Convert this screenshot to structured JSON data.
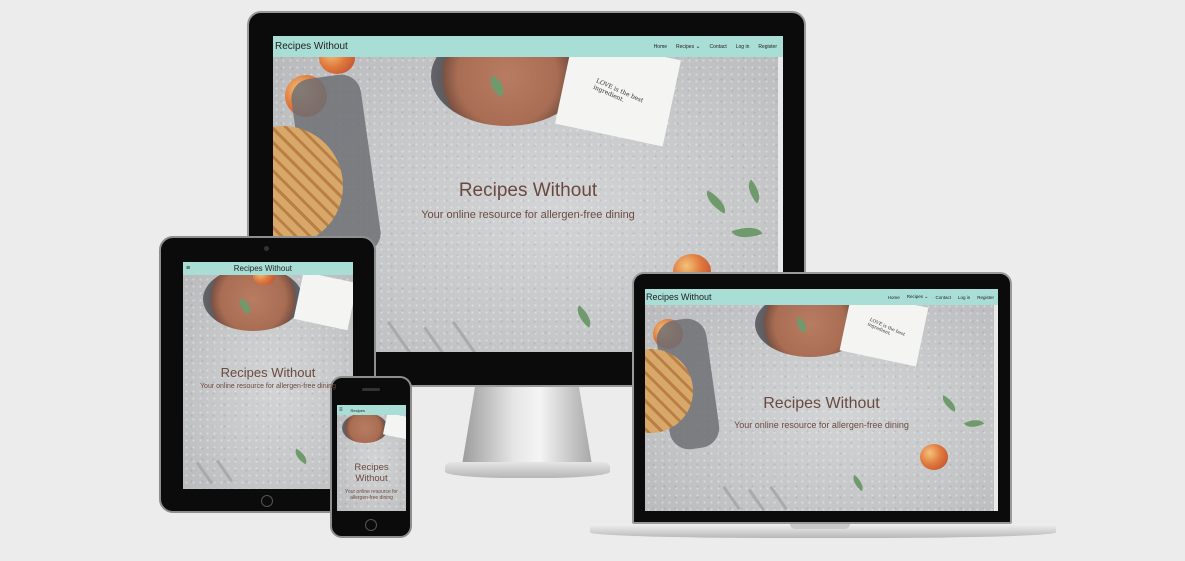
{
  "site": {
    "brand": "Recipes Without",
    "nav": [
      "Home",
      "Recipes",
      "Contact",
      "Log in",
      "Register"
    ],
    "hero_title": "Recipes Without",
    "hero_subtitle": "Your online resource for allergen-free dining",
    "napkin_text": "LOVE is the best ingredient.",
    "phone_nav_brand": "Recipes",
    "phone_hero_title": "Recipes Without",
    "phone_hero_subtitle": "Your online resource for allergen-free dining"
  },
  "colors": {
    "navbar": "#a8ded5",
    "hero_text": "#6a4a40",
    "background": "#ececec"
  },
  "icons": {
    "dropdown": "chevron-down-icon",
    "menu": "hamburger-icon"
  }
}
